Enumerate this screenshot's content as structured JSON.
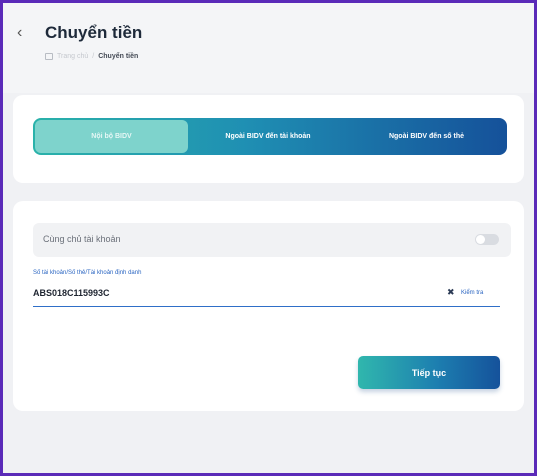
{
  "header": {
    "title": "Chuyển tiền",
    "back_icon": "chevron-left-icon",
    "back_glyph": "‹",
    "breadcrumb": {
      "home_icon": "home-icon",
      "home_label": "Trang chủ",
      "separator": "/",
      "current": "Chuyển tiền"
    }
  },
  "tabs": [
    {
      "label": "Nội bộ BIDV",
      "active": true
    },
    {
      "label": "Ngoài BIDV đến tài khoản",
      "active": false
    },
    {
      "label": "Ngoài BIDV đến số thẻ",
      "active": false
    }
  ],
  "form": {
    "toggle_label": "Cùng chủ tài khoản",
    "toggle_on": false,
    "account_field": {
      "label": "Số tài khoản/Số thẻ/Tài khoản định danh",
      "value": "ABS018C115993C"
    },
    "clear_icon": "close-icon",
    "clear_glyph": "✖",
    "check_label": "Kiểm tra",
    "continue_label": "Tiếp tục"
  },
  "colors": {
    "frame_border": "#5a2ab8",
    "accent_teal": "#2ab2aa",
    "accent_blue": "#15519a",
    "link_blue": "#2b66c2"
  }
}
